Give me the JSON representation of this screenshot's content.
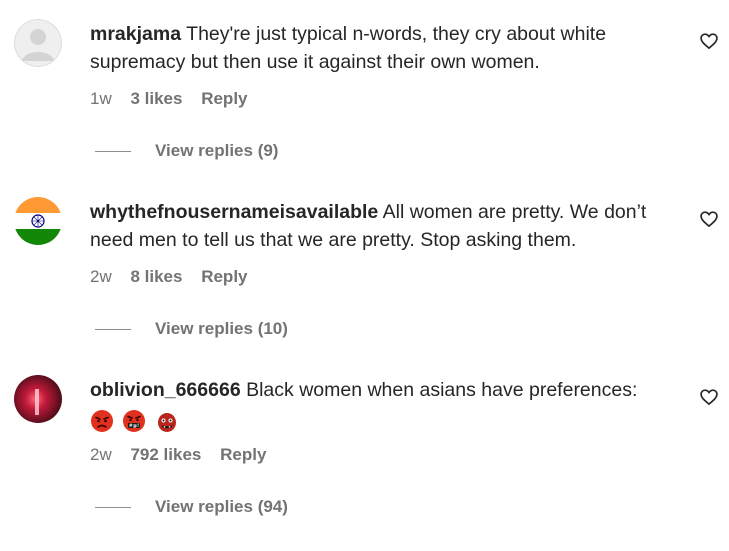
{
  "comments": [
    {
      "username": "mrakjama",
      "text": "They're just typical n-words, they cry about white supremacy but then use it against their own women.",
      "time": "1w",
      "likes": "3 likes",
      "reply_label": "Reply",
      "view_replies": "View replies (9)",
      "avatar": "default-avatar-icon"
    },
    {
      "username": "whythefnousernameisavailable",
      "text": "All women are pretty. We don’t need men to tell us that we are pretty. Stop asking them.",
      "time": "2w",
      "likes": "8 likes",
      "reply_label": "Reply",
      "view_replies": "View replies (10)",
      "avatar": "india-flag-avatar"
    },
    {
      "username": "oblivion_666666",
      "text": "Black women when asians have preferences:",
      "emojis": [
        "angry-face-emoji",
        "cursing-face-emoji",
        "ogre-emoji"
      ],
      "time": "2w",
      "likes": "792 likes",
      "reply_label": "Reply",
      "view_replies": "View replies (94)",
      "avatar": "red-light-avatar"
    }
  ],
  "colors": {
    "text": "#262626",
    "secondary": "#737373",
    "emoji_red": "#e0301e"
  },
  "icons": [
    "heart-outline-icon"
  ]
}
